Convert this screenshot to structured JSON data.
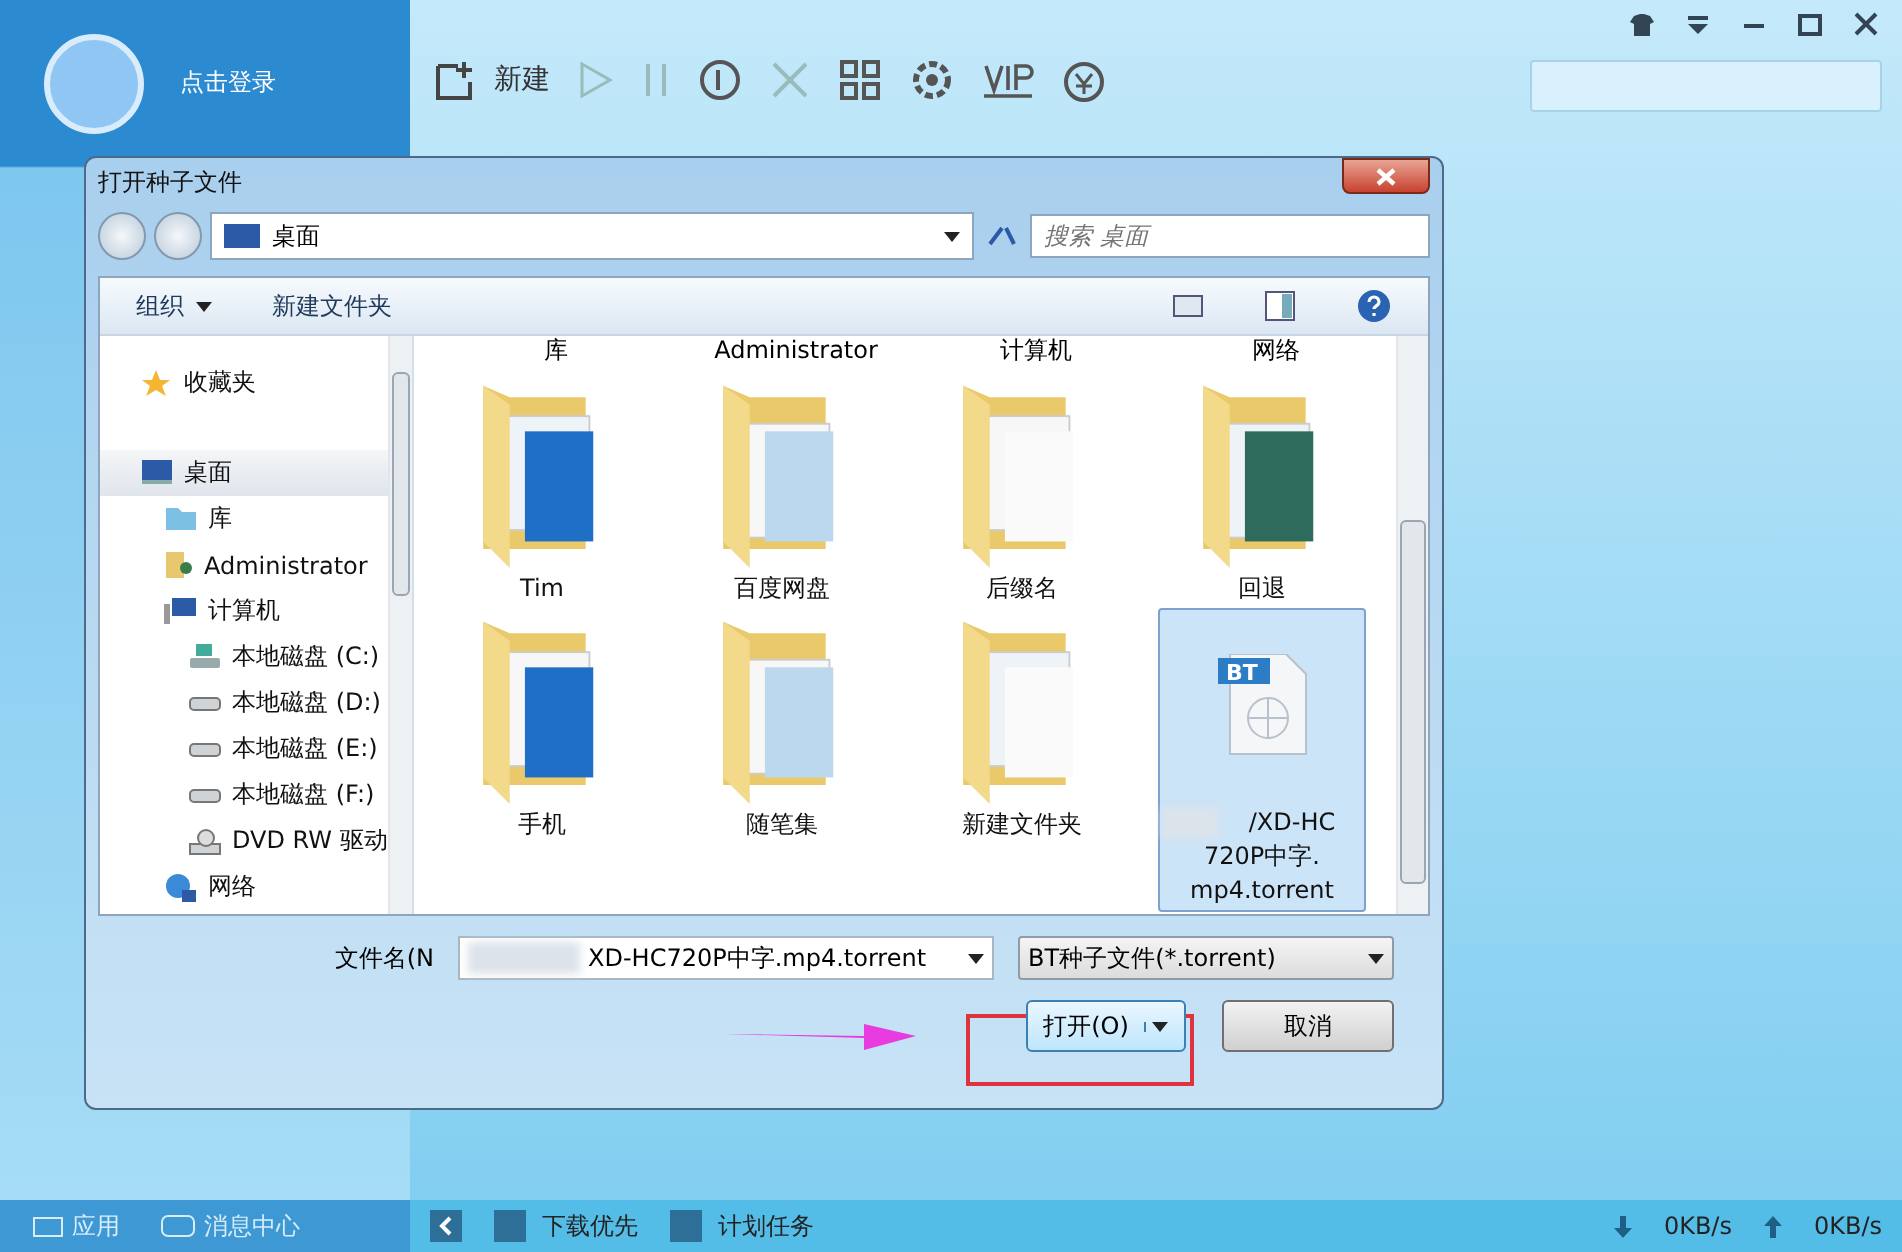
{
  "app": {
    "login": "点击登录",
    "toolbar": {
      "new_label": "新建"
    },
    "sidebar_bottom": [
      "应用",
      "消息中心"
    ]
  },
  "dialog": {
    "title": "打开种子文件",
    "address": "桌面",
    "search_placeholder": "搜索 桌面",
    "commands": [
      "组织",
      "新建文件夹"
    ],
    "nav": [
      {
        "label": "收藏夹",
        "kind": "star",
        "selected": false
      },
      {
        "label": "桌面",
        "kind": "desktop",
        "selected": true,
        "children": [
          {
            "label": "库",
            "kind": "library",
            "selected": false
          },
          {
            "label": "Administrator",
            "kind": "user",
            "selected": false
          },
          {
            "label": "计算机",
            "kind": "computer",
            "selected": false,
            "children": [
              {
                "label": "本地磁盘 (C:)",
                "kind": "sysdrive",
                "selected": false
              },
              {
                "label": "本地磁盘 (D:)",
                "kind": "drive",
                "selected": false
              },
              {
                "label": "本地磁盘 (E:)",
                "kind": "drive",
                "selected": false
              },
              {
                "label": "本地磁盘 (F:)",
                "kind": "drive",
                "selected": false
              },
              {
                "label": "DVD RW 驱动",
                "kind": "dvd",
                "selected": false
              }
            ]
          },
          {
            "label": "网络",
            "kind": "network",
            "selected": false
          }
        ]
      }
    ],
    "top_labels": [
      "库",
      "Administrator",
      "计算机",
      "网络"
    ],
    "items": [
      {
        "label": "Tim",
        "kind": "folder",
        "selected": false
      },
      {
        "label": "百度网盘",
        "kind": "folder",
        "selected": false
      },
      {
        "label": "后缀名",
        "kind": "folder",
        "selected": false
      },
      {
        "label": "回退",
        "kind": "folder",
        "selected": false
      },
      {
        "label": "手机",
        "kind": "folder",
        "selected": false
      },
      {
        "label": "随笔集",
        "kind": "folder",
        "selected": false
      },
      {
        "label": "新建文件夹",
        "kind": "folder",
        "selected": false
      },
      {
        "label": "/XD-HC 720P中字. mp4.torrent",
        "kind": "torrent",
        "selected": true,
        "icon_tag": "BT"
      }
    ],
    "filename_label": "文件名(N",
    "filename_value": "XD-HC720P中字.mp4.torrent",
    "filter": "BT种子文件(*.torrent)",
    "open": "打开(O)",
    "cancel": "取消"
  },
  "status": {
    "items": [
      "下载优先",
      "计划任务"
    ],
    "down": "0KB/s",
    "up": "0KB/s"
  }
}
